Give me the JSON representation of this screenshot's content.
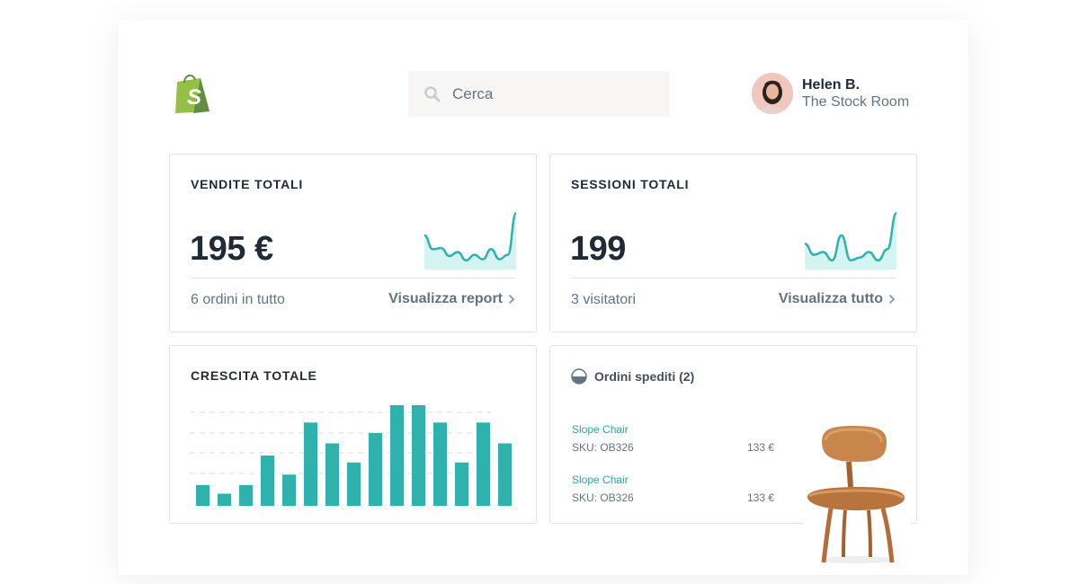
{
  "search": {
    "placeholder": "Cerca"
  },
  "user": {
    "name": "Helen B.",
    "store": "The Stock Room"
  },
  "sales_card": {
    "title": "VENDITE TOTALI",
    "value": "195 €",
    "subtitle": "6 ordini in tutto",
    "link": "Visualizza report"
  },
  "sessions_card": {
    "title": "SESSIONI TOTALI",
    "value": "199",
    "subtitle": "3 visitatori",
    "link": "Visualizza tutto"
  },
  "growth_card": {
    "title": "CRESCITA TOTALE"
  },
  "orders_card": {
    "title": "Ordini spediti (2)",
    "items": [
      {
        "name": "Slope Chair",
        "sku": "SKU: OB326",
        "price": "133 €"
      },
      {
        "name": "Slope Chair",
        "sku": "SKU: OB326",
        "price": "133 €"
      }
    ]
  },
  "colors": {
    "accent": "#2fb2ab",
    "fill": "#d3f4f1",
    "logo": "#95bf47"
  },
  "chart_data": [
    {
      "type": "line",
      "values": [
        0.55,
        0.3,
        0.32,
        0.18,
        0.25,
        0.1,
        0.2,
        0.12,
        0.3,
        0.12,
        0.2,
        0.95
      ]
    },
    {
      "type": "line",
      "values": [
        0.4,
        0.2,
        0.25,
        0.1,
        0.55,
        0.1,
        0.15,
        0.25,
        0.1,
        0.3,
        0.95
      ]
    },
    {
      "type": "bar",
      "values": [
        12,
        7,
        12,
        29,
        18,
        48,
        36,
        25,
        42,
        58,
        58,
        48,
        25,
        48,
        36
      ]
    }
  ]
}
